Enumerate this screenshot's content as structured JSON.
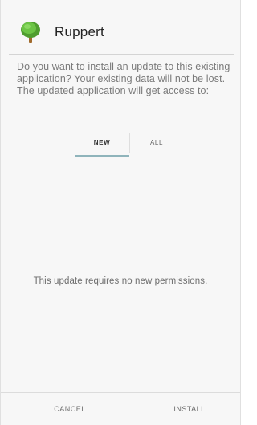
{
  "header": {
    "app_icon": "tree-icon",
    "app_name": "Ruppert"
  },
  "message": "Do you want to install an update to this existing application? Your existing data will not be lost. The updated application will get access to:",
  "tabs": [
    {
      "label": "NEW",
      "selected": true
    },
    {
      "label": "ALL",
      "selected": false
    }
  ],
  "content": {
    "no_permissions_text": "This update requires no new permissions."
  },
  "footer": {
    "cancel_label": "CANCEL",
    "install_label": "INSTALL"
  },
  "colors": {
    "tab_indicator": "#8fb4bb",
    "icon_foliage": "#5fb53a",
    "icon_trunk": "#a06a2c"
  }
}
